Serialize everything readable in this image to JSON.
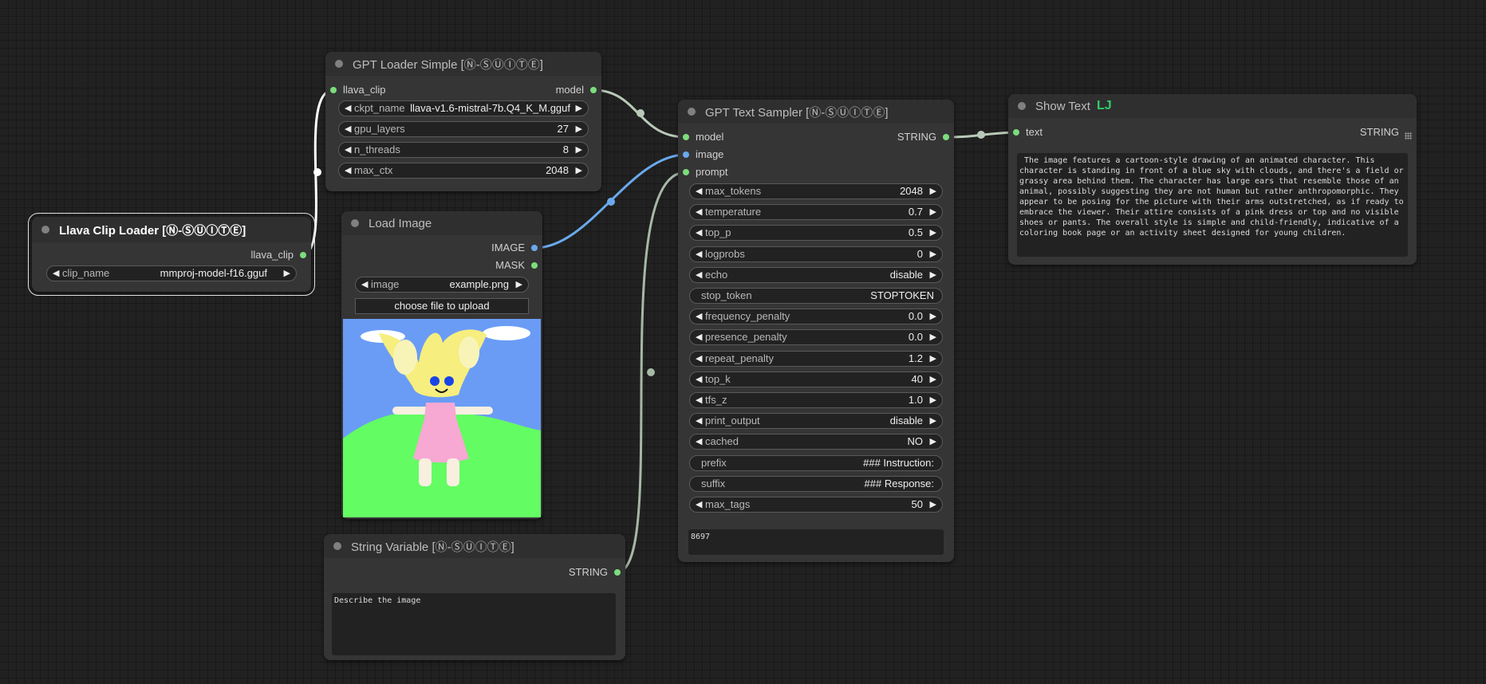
{
  "nodes": {
    "gpt_loader": {
      "title": "GPT Loader Simple [Ⓝ-ⓈⓊⒾⓉⒺ]",
      "input": "llava_clip",
      "output": "model",
      "widgets": [
        {
          "label": "ckpt_name",
          "value": "llava-v1.6-mistral-7b.Q4_K_M.gguf"
        },
        {
          "label": "gpu_layers",
          "value": "27"
        },
        {
          "label": "n_threads",
          "value": "8"
        },
        {
          "label": "max_ctx",
          "value": "2048"
        }
      ]
    },
    "llava_clip": {
      "title": "Llava Clip Loader [Ⓝ-ⓈⓊⒾⓉⒺ]",
      "output": "llava_clip",
      "widget": {
        "label": "clip_name",
        "value": "mmproj-model-f16.gguf"
      }
    },
    "load_image": {
      "title": "Load Image",
      "outputs": [
        "IMAGE",
        "MASK"
      ],
      "widget": {
        "label": "image",
        "value": "example.png"
      },
      "upload_label": "choose file to upload"
    },
    "string_var": {
      "title": "String Variable [Ⓝ-ⓈⓊⒾⓉⒺ]",
      "output": "STRING",
      "text": "Describe the image"
    },
    "sampler": {
      "title": "GPT Text Sampler [Ⓝ-ⓈⓊⒾⓉⒺ]",
      "inputs": [
        "model",
        "image",
        "prompt"
      ],
      "output": "STRING",
      "widgets": [
        {
          "label": "max_tokens",
          "value": "2048",
          "arrows": true
        },
        {
          "label": "temperature",
          "value": "0.7",
          "arrows": true
        },
        {
          "label": "top_p",
          "value": "0.5",
          "arrows": true
        },
        {
          "label": "logprobs",
          "value": "0",
          "arrows": true
        },
        {
          "label": "echo",
          "value": "disable",
          "arrows": true
        },
        {
          "label": "stop_token",
          "value": "STOPTOKEN",
          "arrows": false
        },
        {
          "label": "frequency_penalty",
          "value": "0.0",
          "arrows": true
        },
        {
          "label": "presence_penalty",
          "value": "0.0",
          "arrows": true
        },
        {
          "label": "repeat_penalty",
          "value": "1.2",
          "arrows": true
        },
        {
          "label": "top_k",
          "value": "40",
          "arrows": true
        },
        {
          "label": "tfs_z",
          "value": "1.0",
          "arrows": true
        },
        {
          "label": "print_output",
          "value": "disable",
          "arrows": true
        },
        {
          "label": "cached",
          "value": "NO",
          "arrows": true
        },
        {
          "label": "prefix",
          "value": "### Instruction:",
          "arrows": false
        },
        {
          "label": "suffix",
          "value": "### Response:",
          "arrows": false
        },
        {
          "label": "max_tags",
          "value": "50",
          "arrows": true
        }
      ],
      "seed": "8697"
    },
    "show_text": {
      "title": "Show Text",
      "badge": "Ǉ",
      "input": "text",
      "output": "STRING",
      "text": " The image features a cartoon-style drawing of an animated character. This character is standing in front of a blue sky with clouds, and there's a field or grassy area behind them. The character has large ears that resemble those of an animal, possibly suggesting they are not human but rather anthropomorphic. They appear to be posing for the picture with their arms outstretched, as if ready to embrace the viewer. Their attire consists of a pink dress or top and no visible shoes or pants. The overall style is simple and child-friendly, indicative of a coloring book page or an activity sheet designed for young children."
    }
  },
  "colors": {
    "wire_model": "#b9c9b9",
    "wire_image": "#6aa9ec",
    "wire_string": "#a6b8a6",
    "wire_clip": "#ffffff",
    "sky": "#6a9cf6",
    "grass": "#63fc63",
    "dress": "#f7a8d3",
    "hair": "#f6ee7e"
  }
}
